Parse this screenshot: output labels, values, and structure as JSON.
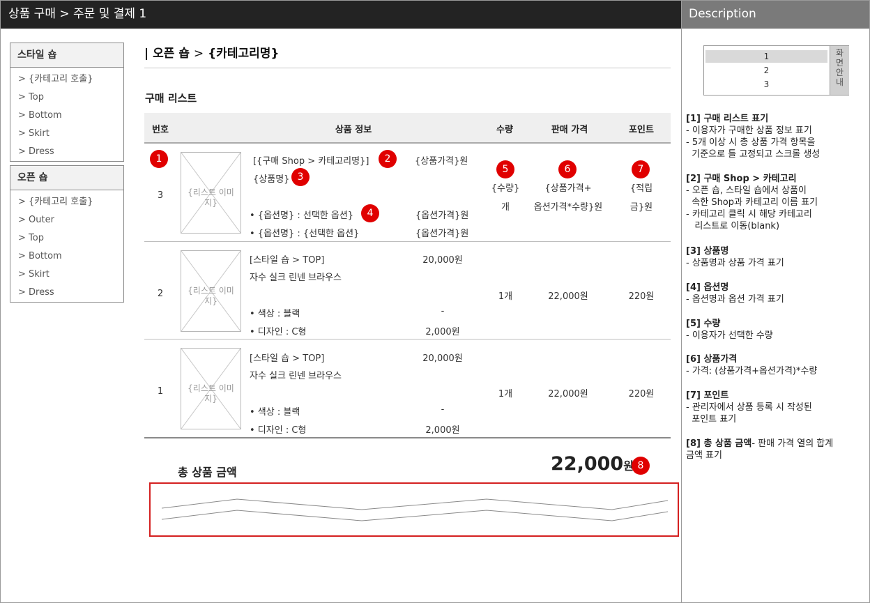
{
  "header": {
    "title": "상품 구매 > 주문 및 결제 1",
    "description_title": "Description"
  },
  "sidebar": {
    "style_shop": {
      "title": "스타일 숍",
      "items": [
        "> {카테고리 호출}",
        "> Top",
        "> Bottom",
        "> Skirt",
        "> Dress"
      ]
    },
    "open_shop": {
      "title": "오픈 숍",
      "items": [
        "> {카테고리 호출}",
        "> Outer",
        "> Top",
        "> Bottom",
        "> Skirt",
        "> Dress"
      ]
    }
  },
  "breadcrumb": {
    "bar": "|",
    "shop": "오픈 숍",
    "sep": ">",
    "category": "{카테고리명}"
  },
  "section_title": "구매 리스트",
  "table": {
    "headers": {
      "no": "번호",
      "info": "상품 정보",
      "qty": "수량",
      "price": "판매 가격",
      "point": "포인트"
    },
    "rows": [
      {
        "no": "3",
        "thumb": "{리스트 이미지}",
        "shop": "[{구매 Shop > 카테고리명}]",
        "name": "{상품명}",
        "unit_price": "{상품가격}원",
        "opt1": "• {옵션명} : 선택한 옵션}",
        "opt1_price": "{옵션가격}원",
        "opt2": "• {옵션명} : {선택한 옵션}",
        "opt2_price": "{옵션가격}원",
        "qty_line1": "{수량}",
        "qty_line2": "개",
        "price_line1": "{상품가격+",
        "price_line2": "옵션가격*수량}원",
        "point_line1": "{적립",
        "point_line2": "금}원"
      },
      {
        "no": "2",
        "thumb": "{리스트 이미지}",
        "shop": "[스타일 숍 > TOP]",
        "name": "자수 실크 린넨 브라우스",
        "unit_price": "20,000원",
        "opt1": "• 색상 : 블랙",
        "opt1_price": "-",
        "opt2": "• 디자인 : C형",
        "opt2_price": "2,000원",
        "qty": "1개",
        "price": "22,000원",
        "point": "220원"
      },
      {
        "no": "1",
        "thumb": "{리스트 이미지}",
        "shop": "[스타일 숍 > TOP]",
        "name": "자수 실크 린넨 브라우스",
        "unit_price": "20,000원",
        "opt1": "• 색상 : 블랙",
        "opt1_price": "-",
        "opt2": "• 디자인 : C형",
        "opt2_price": "2,000원",
        "qty": "1개",
        "price": "22,000원",
        "point": "220원"
      }
    ]
  },
  "total": {
    "label": "총 상품 금액",
    "amount": "22,000",
    "unit": "원"
  },
  "badges": [
    "1",
    "2",
    "3",
    "4",
    "5",
    "6",
    "7",
    "8"
  ],
  "mini_nav": {
    "items": [
      "1",
      "2",
      "3"
    ],
    "side": "화면안내"
  },
  "description": [
    {
      "h": "[1] 구매 리스트 표기",
      "lines": [
        "- 이용자가 구매한 상품 정보 표기",
        "- 5개 이상 시 총 상품 가격 항목을",
        "  기준으로 틀 고정되고 스크롤 생성"
      ]
    },
    {
      "h": "[2] 구매 Shop > 카테고리",
      "lines": [
        "- 오픈 숍, 스타일 숍에서 상품이",
        "  속한 Shop과 카테고리 이름 표기",
        "- 카테고리 클릭 시 해당 카테고리",
        "   리스트로 이동(blank)"
      ]
    },
    {
      "h": "[3] 상품명",
      "lines": [
        "- 상품명과 상품 가격 표기"
      ]
    },
    {
      "h": "[4] 옵션명",
      "lines": [
        "- 옵션명과 옵션 가격 표기"
      ]
    },
    {
      "h": "[5] 수량",
      "lines": [
        "- 이용자가 선택한 수량"
      ]
    },
    {
      "h": "[6] 상품가격",
      "lines": [
        "- 가격: (상품가격+옵션가격)*수량"
      ]
    },
    {
      "h": "[7] 포인트",
      "lines": [
        "- 관리자에서 상품 등록 시 작성된",
        "  포인트 표기"
      ]
    },
    {
      "h": "[8] 총 상품 금액",
      "inline": "- 판매 가격 열의 합계",
      "lines": [
        "금액 표기"
      ]
    }
  ],
  "colors": {
    "topbar": "#232323",
    "descbar": "#7a7a7a",
    "badge": "#e00000",
    "redbox": "#d42020"
  }
}
